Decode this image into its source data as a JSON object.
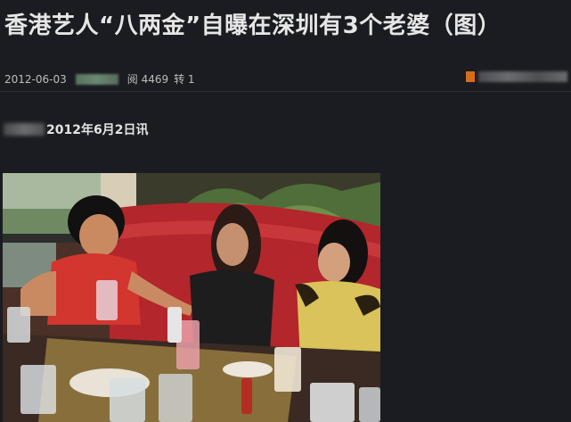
{
  "article": {
    "title": "香港艺人“八两金”自曝在深圳有3个老婆（图）",
    "date": "2012-06-03",
    "reads": "阅 4469",
    "reposts": "转 1",
    "dateline": "2012年6月2日讯"
  },
  "colors": {
    "background": "#1b1c21",
    "title_text": "#e6e6e6",
    "meta_text": "#bdbdbd",
    "accent_orange": "#d66d1b"
  },
  "photo": {
    "icon": "news-photo"
  }
}
